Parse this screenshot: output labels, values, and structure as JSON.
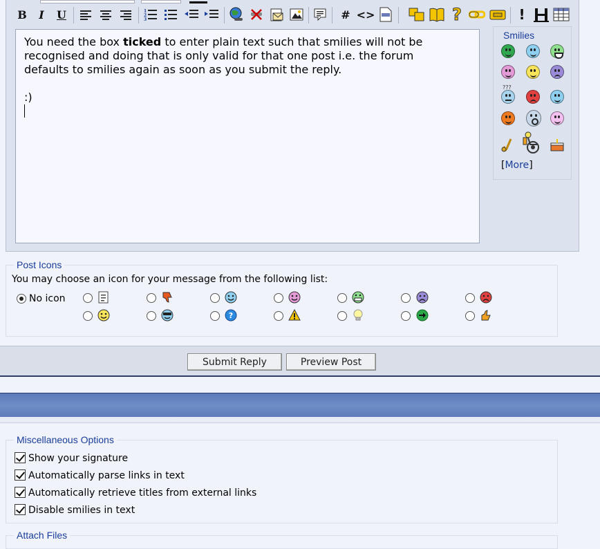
{
  "toolbar": {
    "bold_label": "B",
    "italic_label": "I",
    "underline_label": "U",
    "hash_label": "#",
    "code_label": "<>",
    "help_label": "?",
    "exclaim_label": "!"
  },
  "editor": {
    "line1_pre": "You need the box ",
    "line1_bold": "ticked",
    "line1_post": " to enter plain text such that smilies will not be",
    "line2": "recognised and doing that is only valid for that one post i.e. the forum",
    "line3": "defaults to smilies again as soon as you submit the reply.",
    "line5": ":)"
  },
  "smilies": {
    "title": "Smilies",
    "more_open": "[",
    "more_label": "More",
    "more_close": "]",
    "items": [
      {
        "icon": "green-face-icon"
      },
      {
        "icon": "smile-blue-icon"
      },
      {
        "icon": "grin-green-icon"
      },
      {
        "icon": "pink-face-icon"
      },
      {
        "icon": "smile-yellow-icon"
      },
      {
        "icon": "frown-purple-icon"
      },
      {
        "icon": "confused-icon"
      },
      {
        "icon": "mad-icon"
      },
      {
        "icon": "rolleyes-icon"
      },
      {
        "icon": "cool-orange-icon"
      },
      {
        "icon": "eek-icon"
      },
      {
        "icon": "tongue-icon"
      },
      {
        "icon": "saxophone-icon"
      },
      {
        "icon": "wheelchair-icon"
      },
      {
        "icon": "cake-icon"
      }
    ],
    "confused_marks": "???"
  },
  "post_icons": {
    "legend": "Post Icons",
    "description": "You may choose an icon for your message from the following list:",
    "no_icon_label": "No icon",
    "selected": "no-icon"
  },
  "buttons": {
    "submit": "Submit Reply",
    "preview": "Preview Post"
  },
  "misc": {
    "legend": "Miscellaneous Options",
    "options": [
      {
        "label": "Show your signature",
        "checked": true
      },
      {
        "label": "Automatically parse links in text",
        "checked": true
      },
      {
        "label": "Automatically retrieve titles from external links",
        "checked": true
      },
      {
        "label": "Disable smilies in text",
        "checked": true
      }
    ]
  },
  "attach": {
    "legend": "Attach Files"
  },
  "colors": {
    "accent_blue": "#1a3d9a",
    "band_blue": "#6f8dc6",
    "panel_bg": "#dde3ee",
    "page_bg": "#f0f3fa"
  }
}
